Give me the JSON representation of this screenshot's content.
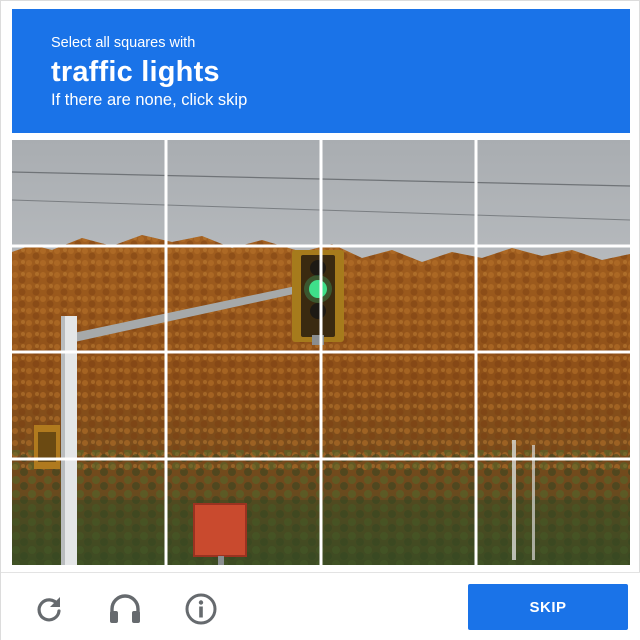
{
  "challenge": {
    "instruction": "Select all squares with",
    "target": "traffic lights",
    "hint": "If there are none, click skip"
  },
  "grid": {
    "rows": 4,
    "cols": 4,
    "tiles": [
      "1",
      "2",
      "3",
      "4",
      "5",
      "6",
      "7",
      "8",
      "9",
      "10",
      "11",
      "12",
      "13",
      "14",
      "15",
      "16"
    ]
  },
  "footer": {
    "reload_icon": "reload-icon",
    "audio_icon": "headphones-icon",
    "info_icon": "info-icon",
    "skip_label": "SKIP"
  },
  "colors": {
    "accent": "#1a73e8",
    "sky": "#b9bcbf",
    "foliage": "#9b5a1c",
    "signal_green": "#3ee08a"
  }
}
